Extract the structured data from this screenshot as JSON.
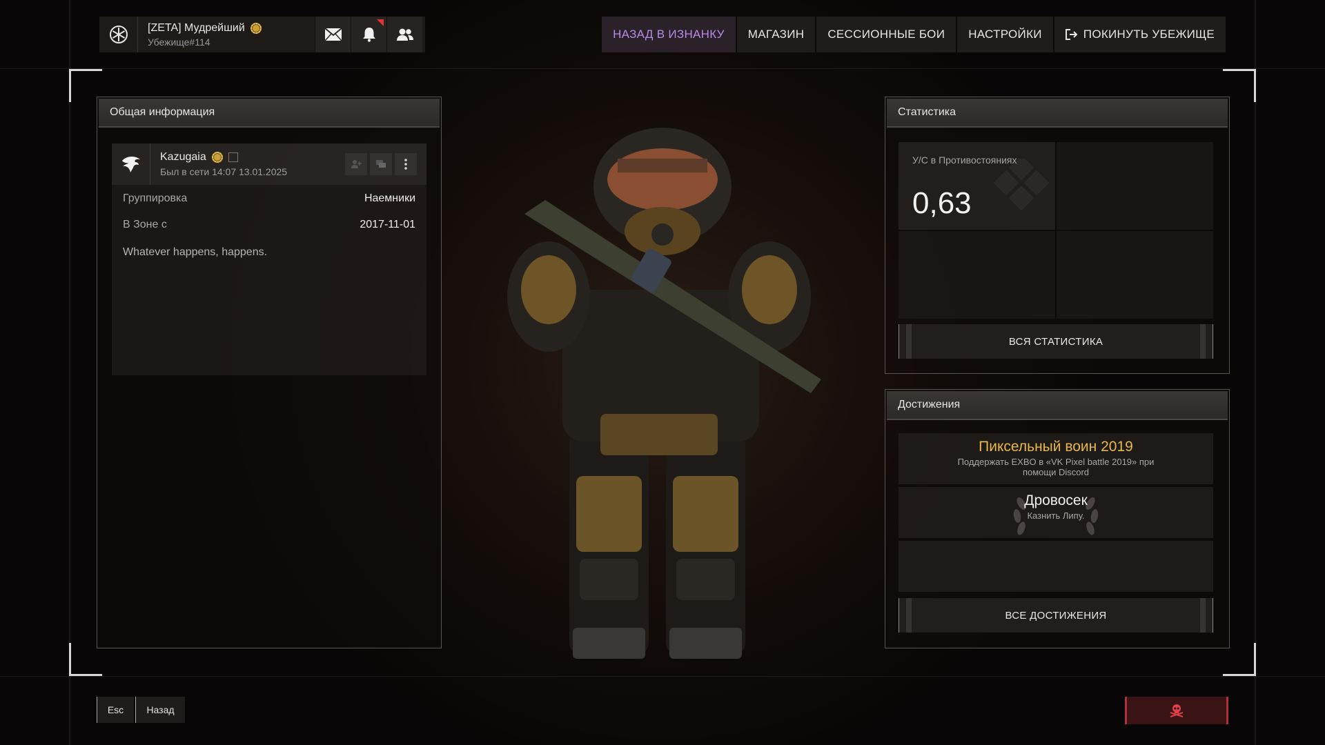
{
  "header": {
    "user_name": "[ZETA] Мудрейший",
    "user_sub": "Убежище#114",
    "nav": {
      "back": "НАЗАД В ИЗНАНКУ",
      "shop": "МАГАЗИН",
      "session": "СЕССИОННЫЕ БОИ",
      "settings": "НАСТРОЙКИ",
      "leave": "ПОКИНУТЬ УБЕЖИЩЕ"
    }
  },
  "info_panel": {
    "title": "Общая информация",
    "player_name": "Kazugaia",
    "last_seen": "Был в сети 14:07 13.01.2025",
    "faction_label": "Группировка",
    "faction_value": "Наемники",
    "zone_label": "В Зоне с",
    "zone_value": "2017-11-01",
    "bio": "Whatever happens, happens."
  },
  "stats_panel": {
    "title": "Статистика",
    "kd_label": "У/С в Противостояниях",
    "kd_value": "0,63",
    "all_stats": "ВСЯ СТАТИСТИКА"
  },
  "achievements_panel": {
    "title": "Достижения",
    "items": [
      {
        "title": "Пиксельный воин 2019",
        "desc": "Поддержать EXBO в «VK Pixel battle 2019» при помощи Discord"
      },
      {
        "title": "Дровосек",
        "desc": "Казнить Липу."
      }
    ],
    "all_achievements": "ВСЕ ДОСТИЖЕНИЯ"
  },
  "footer": {
    "esc_key": "Esc",
    "back_label": "Назад"
  },
  "colors": {
    "accent_nav": "#b98be8",
    "gold": "#e8b84a",
    "report": "#b0303a"
  }
}
